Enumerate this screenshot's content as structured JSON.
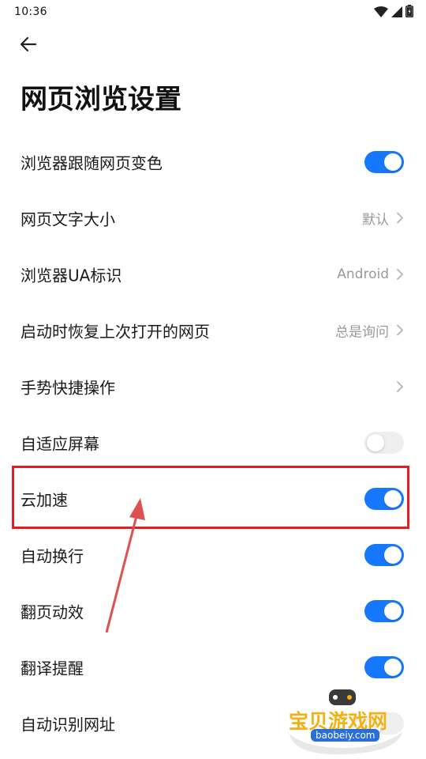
{
  "status_bar": {
    "time": "10:36",
    "icons": [
      "wifi-icon",
      "signal-icon",
      "battery-icon"
    ]
  },
  "header": {
    "back_icon": "arrow-left-icon",
    "title": "网页浏览设置"
  },
  "settings": [
    {
      "label": "浏览器跟随网页变色",
      "type": "toggle",
      "on": true
    },
    {
      "label": "网页文字大小",
      "type": "nav",
      "value": "默认"
    },
    {
      "label": "浏览器UA标识",
      "type": "nav",
      "value": "Android"
    },
    {
      "label": "启动时恢复上次打开的网页",
      "type": "nav",
      "value": "总是询问"
    },
    {
      "label": "手势快捷操作",
      "type": "nav",
      "value": ""
    },
    {
      "label": "自适应屏幕",
      "type": "toggle",
      "on": false
    },
    {
      "label": "云加速",
      "type": "toggle",
      "on": true
    },
    {
      "label": "自动换行",
      "type": "toggle",
      "on": true
    },
    {
      "label": "翻页动效",
      "type": "toggle",
      "on": true
    },
    {
      "label": "翻译提醒",
      "type": "toggle",
      "on": true
    },
    {
      "label": "自动识别网址",
      "type": "toggle",
      "on": false
    }
  ],
  "annotation": {
    "highlighted_item": "云加速",
    "color": "#e02020"
  },
  "watermark": {
    "text": "宝贝游戏网",
    "url": "baobeiy.com"
  },
  "colors": {
    "accent": "#1677ff",
    "toggle_off": "#efefef",
    "secondary_text": "#999999"
  }
}
